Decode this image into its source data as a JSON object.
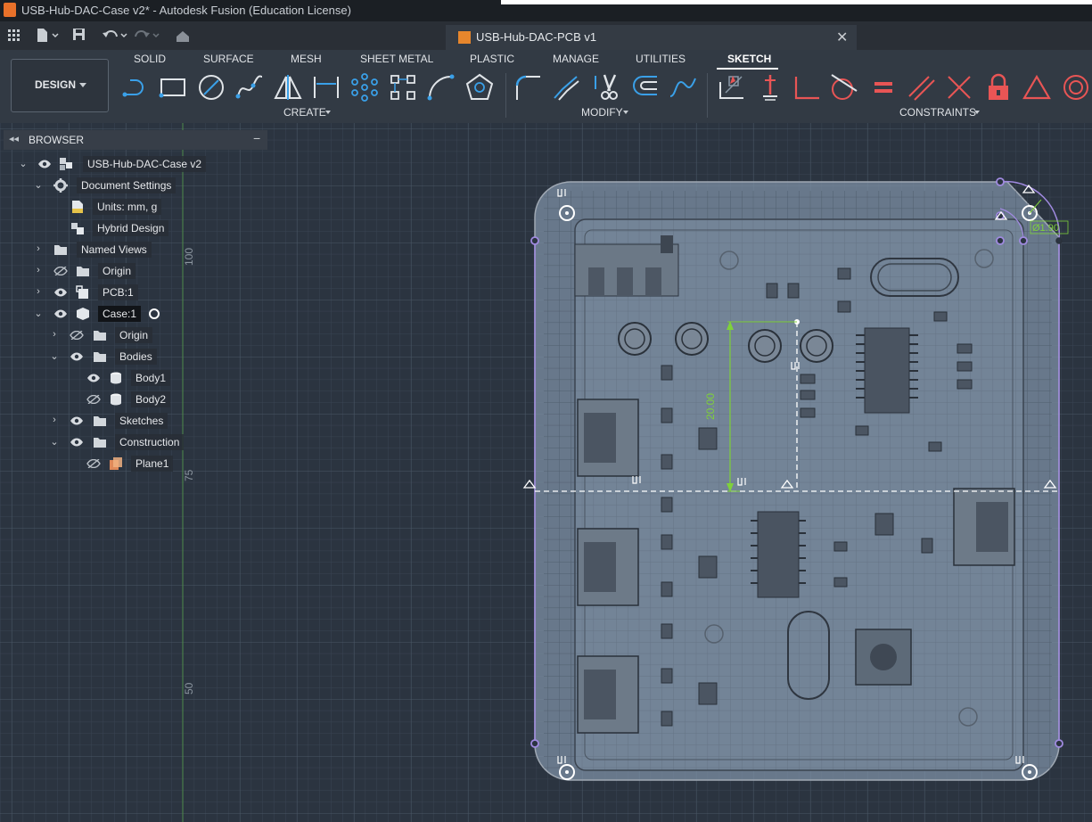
{
  "window": {
    "title": "USB-Hub-DAC-Case v2* - Autodesk Fusion (Education License)"
  },
  "document_tab": {
    "title": "USB-Hub-DAC-PCB v1",
    "close": "✕"
  },
  "ribbon": {
    "workspace": "DESIGN",
    "tabs": [
      "SOLID",
      "SURFACE",
      "MESH",
      "SHEET METAL",
      "PLASTIC",
      "MANAGE",
      "UTILITIES",
      "SKETCH"
    ],
    "active_tab": "SKETCH",
    "groups": {
      "create": "CREATE",
      "modify": "MODIFY",
      "constraints": "CONSTRAINTS"
    }
  },
  "browser": {
    "title": "BROWSER",
    "items": [
      {
        "label": "USB-Hub-DAC-Case v2"
      },
      {
        "label": "Document Settings"
      },
      {
        "label": "Units: mm, g"
      },
      {
        "label": "Hybrid Design"
      },
      {
        "label": "Named Views"
      },
      {
        "label": "Origin"
      },
      {
        "label": "PCB:1"
      },
      {
        "label": "Case:1"
      },
      {
        "label": "Origin"
      },
      {
        "label": "Bodies"
      },
      {
        "label": "Body1"
      },
      {
        "label": "Body2"
      },
      {
        "label": "Sketches"
      },
      {
        "label": "Construction"
      },
      {
        "label": "Plane1"
      }
    ]
  },
  "canvas": {
    "ruler_labels": [
      "100",
      "75",
      "50"
    ],
    "dimension_linear": "20.00",
    "dimension_diameter": "Ø1.90"
  },
  "colors": {
    "background": "#2b3440",
    "accent_sketch": "#a08ae0",
    "dimension_green": "#7fd13b"
  }
}
